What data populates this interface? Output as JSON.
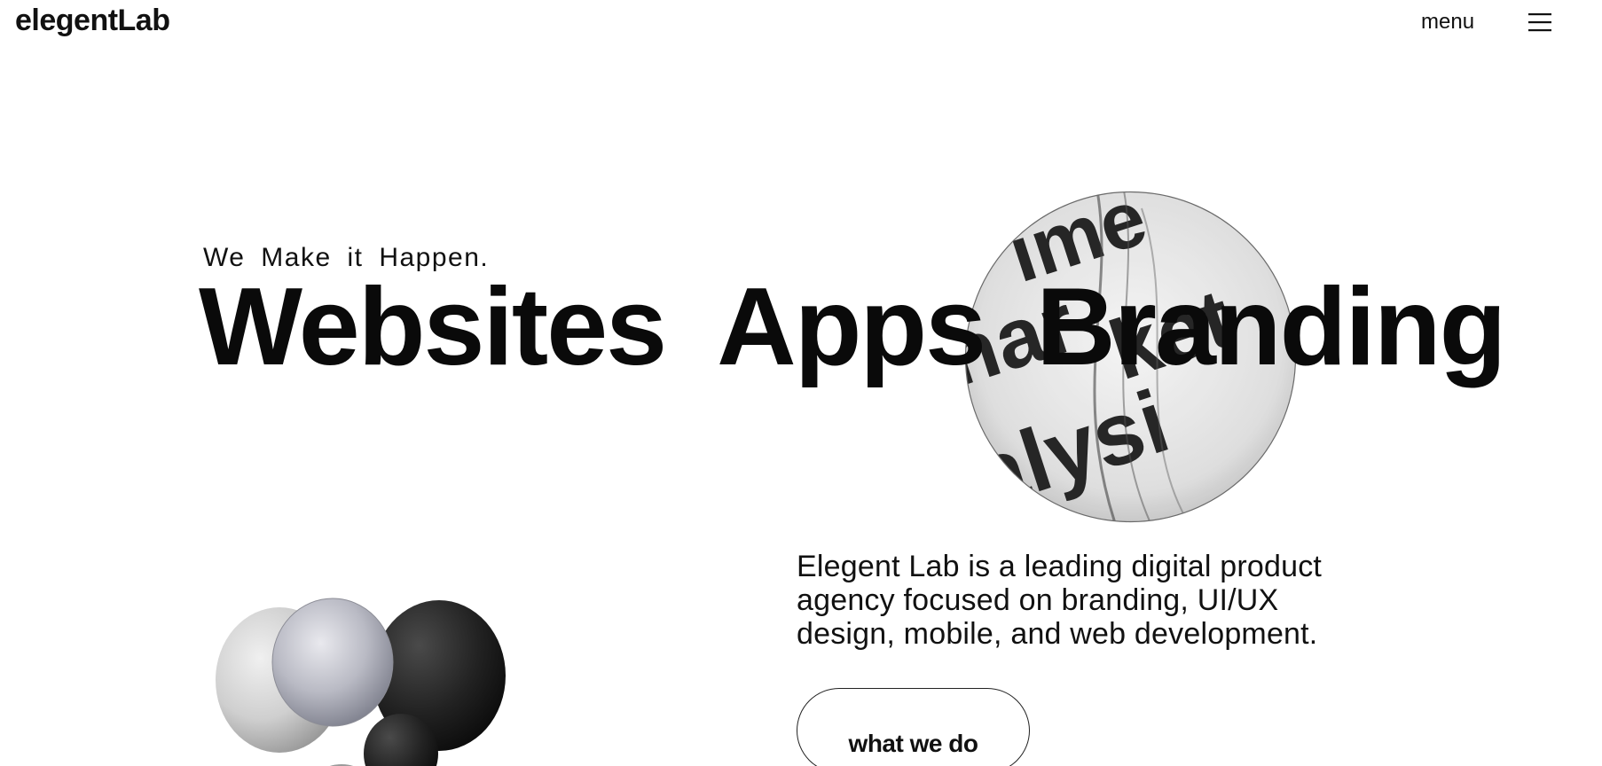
{
  "header": {
    "logo": "elegentLab",
    "menu_label": "menu",
    "menu_icon": "hamburger-icon"
  },
  "hero": {
    "tagline": "We Make it Happen.",
    "headline": [
      "Websites",
      "Apps",
      "Branding"
    ],
    "image_text": [
      "ime",
      "nar",
      "ket",
      "alysi"
    ]
  },
  "intro": {
    "description": "Elegent Lab is a leading digital product agency focused on branding, UI/UX design, mobile, and web development.",
    "cta_label": "what we do"
  },
  "colors": {
    "text": "#0a0a0a",
    "background": "#ffffff",
    "accent": "#000000"
  }
}
